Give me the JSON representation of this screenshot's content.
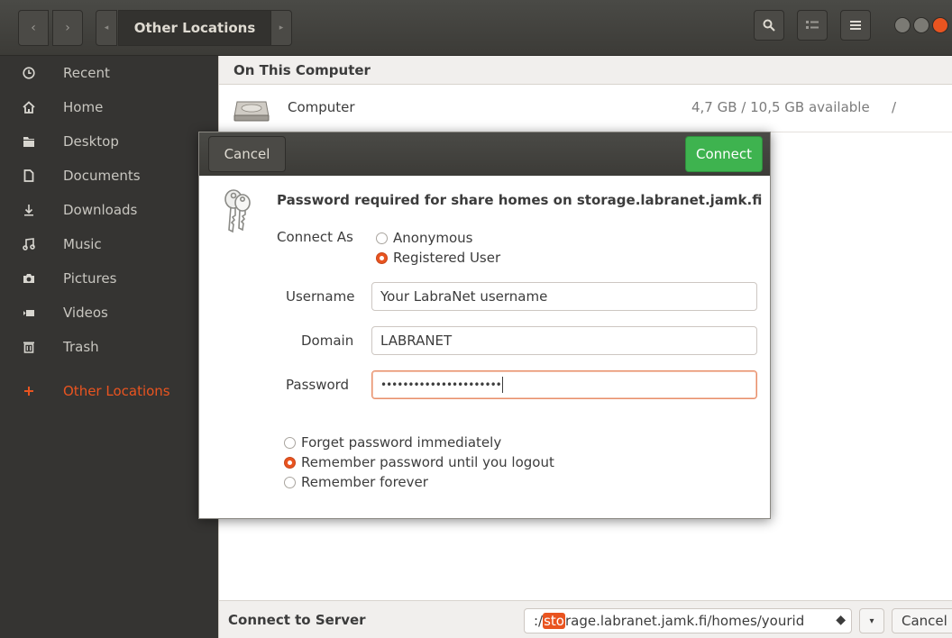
{
  "header": {
    "back_glyph": "‹",
    "forward_glyph": "›",
    "path_left_glyph": "◂",
    "path_right_glyph": "▸",
    "current_location": "Other Locations",
    "icons": [
      "search-icon",
      "view-options-icon",
      "hamburger-menu-icon"
    ]
  },
  "sidebar": {
    "items": [
      {
        "label": "Recent",
        "icon": "clock-icon"
      },
      {
        "label": "Home",
        "icon": "home-icon"
      },
      {
        "label": "Desktop",
        "icon": "folder-icon"
      },
      {
        "label": "Documents",
        "icon": "document-icon"
      },
      {
        "label": "Downloads",
        "icon": "download-icon"
      },
      {
        "label": "Music",
        "icon": "music-icon"
      },
      {
        "label": "Pictures",
        "icon": "camera-icon"
      },
      {
        "label": "Videos",
        "icon": "video-icon"
      },
      {
        "label": "Trash",
        "icon": "trash-icon"
      },
      {
        "label": "Other Locations",
        "icon": "plus-icon",
        "active": true
      }
    ]
  },
  "main": {
    "section_title": "On This Computer",
    "location": {
      "name": "Computer",
      "space": "4,7 GB / 10,5 GB available",
      "mount": "/"
    }
  },
  "connect_bar": {
    "label": "Connect to Server",
    "address_prefix": ":/",
    "address_highlight": "sto",
    "address_rest": "rage.labranet.jamk.fi/homes/yourid",
    "help_glyph": "◆",
    "dropdown_glyph": "▾",
    "cancel_label": "Cancel"
  },
  "dialog": {
    "cancel_label": "Cancel",
    "connect_label": "Connect",
    "title": "Password required for share homes on storage.labranet.jamk.fi",
    "connect_as_label": "Connect As",
    "connect_as_options": [
      {
        "label": "Anonymous",
        "selected": false
      },
      {
        "label": "Registered User",
        "selected": true
      }
    ],
    "username_label": "Username",
    "username_value": "Your LabraNet username",
    "domain_label": "Domain",
    "domain_value": "LABRANET",
    "password_label": "Password",
    "password_value": "••••••••••••••••••••••",
    "remember_options": [
      {
        "label": "Forget password immediately",
        "selected": false
      },
      {
        "label": "Remember password until you logout",
        "selected": true
      },
      {
        "label": "Remember forever",
        "selected": false
      }
    ]
  },
  "colors": {
    "accent": "#e95420",
    "connect_button": "#3eb34f",
    "header_bg": "#3c3b37",
    "sidebar_bg": "#353432"
  }
}
